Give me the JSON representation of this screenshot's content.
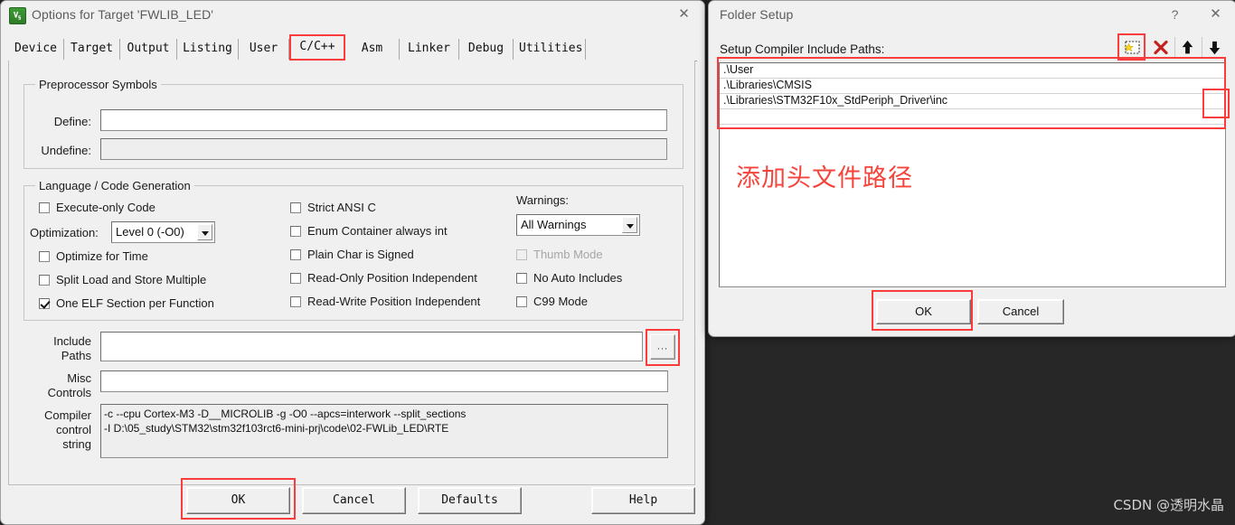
{
  "options_dialog": {
    "title": "Options for Target 'FWLIB_LED'",
    "icon": "keil-uvision-icon",
    "close_label": "✕",
    "tabs": [
      {
        "label": "Device",
        "selected": false
      },
      {
        "label": "Target",
        "selected": false
      },
      {
        "label": "Output",
        "selected": false
      },
      {
        "label": "Listing",
        "selected": false
      },
      {
        "label": "User",
        "selected": false
      },
      {
        "label": "C/C++",
        "selected": true
      },
      {
        "label": "Asm",
        "selected": false
      },
      {
        "label": "Linker",
        "selected": false
      },
      {
        "label": "Debug",
        "selected": false
      },
      {
        "label": "Utilities",
        "selected": false
      }
    ],
    "preprocessor": {
      "group_title": "Preprocessor Symbols",
      "define_label": "Define:",
      "define_value": "",
      "undefine_label": "Undefine:",
      "undefine_value": ""
    },
    "language": {
      "group_title": "Language / Code Generation",
      "left_checks": [
        {
          "label": "Execute-only Code",
          "checked": false,
          "disabled": false
        },
        {
          "label": "Optimize for Time",
          "checked": false,
          "disabled": false
        },
        {
          "label": "Split Load and Store Multiple",
          "checked": false,
          "disabled": false
        },
        {
          "label": "One ELF Section per Function",
          "checked": true,
          "disabled": false
        }
      ],
      "optimization_label": "Optimization:",
      "optimization_value": "Level 0 (-O0)",
      "mid_checks": [
        {
          "label": "Strict ANSI C",
          "checked": false,
          "disabled": false
        },
        {
          "label": "Enum Container always int",
          "checked": false,
          "disabled": false
        },
        {
          "label": "Plain Char is Signed",
          "checked": false,
          "disabled": false
        },
        {
          "label": "Read-Only Position Independent",
          "checked": false,
          "disabled": false
        },
        {
          "label": "Read-Write Position Independent",
          "checked": false,
          "disabled": false
        }
      ],
      "warnings_label": "Warnings:",
      "warnings_value": "All Warnings",
      "right_checks": [
        {
          "label": "Thumb Mode",
          "checked": false,
          "disabled": true
        },
        {
          "label": "No Auto Includes",
          "checked": false,
          "disabled": false
        },
        {
          "label": "C99 Mode",
          "checked": false,
          "disabled": false
        }
      ]
    },
    "paths": {
      "include_label_line1": "Include",
      "include_label_line2": "Paths",
      "include_value": "",
      "include_browse_label": "...",
      "misc_label_line1": "Misc",
      "misc_label_line2": "Controls",
      "misc_value": "",
      "compiler_label_line1": "Compiler",
      "compiler_label_line2": "control",
      "compiler_label_line3": "string",
      "compiler_value_line1": "-c --cpu Cortex-M3 -D__MICROLIB -g -O0 --apcs=interwork --split_sections",
      "compiler_value_line2": "-I D:\\05_study\\STM32\\stm32f103rct6-mini-prj\\code\\02-FWLib_LED\\RTE"
    },
    "buttons": {
      "ok": "OK",
      "cancel": "Cancel",
      "defaults": "Defaults",
      "help": "Help"
    }
  },
  "folder_dialog": {
    "title": "Folder Setup",
    "help_label": "?",
    "close_label": "✕",
    "bar_label": "Setup Compiler Include Paths:",
    "toolbar": [
      {
        "name": "new-folder-icon",
        "tooltip": "New (Insert)"
      },
      {
        "name": "delete-icon",
        "tooltip": "Delete"
      },
      {
        "name": "move-up-icon",
        "tooltip": "Move Up"
      },
      {
        "name": "move-down-icon",
        "tooltip": "Move Down"
      }
    ],
    "paths": [
      ".\\User",
      ".\\Libraries\\CMSIS",
      ".\\Libraries\\STM32F10x_StdPeriph_Driver\\inc"
    ],
    "row_browse_label": "...",
    "annotation": "添加头文件路径",
    "buttons": {
      "ok": "OK",
      "cancel": "Cancel"
    }
  },
  "watermark": "CSDN @透明水晶",
  "colors": {
    "highlight": "#fa3c3c",
    "annotation": "#f4443c",
    "dialog_bg": "#f0f0f0",
    "desktop_bg": "#272727"
  }
}
